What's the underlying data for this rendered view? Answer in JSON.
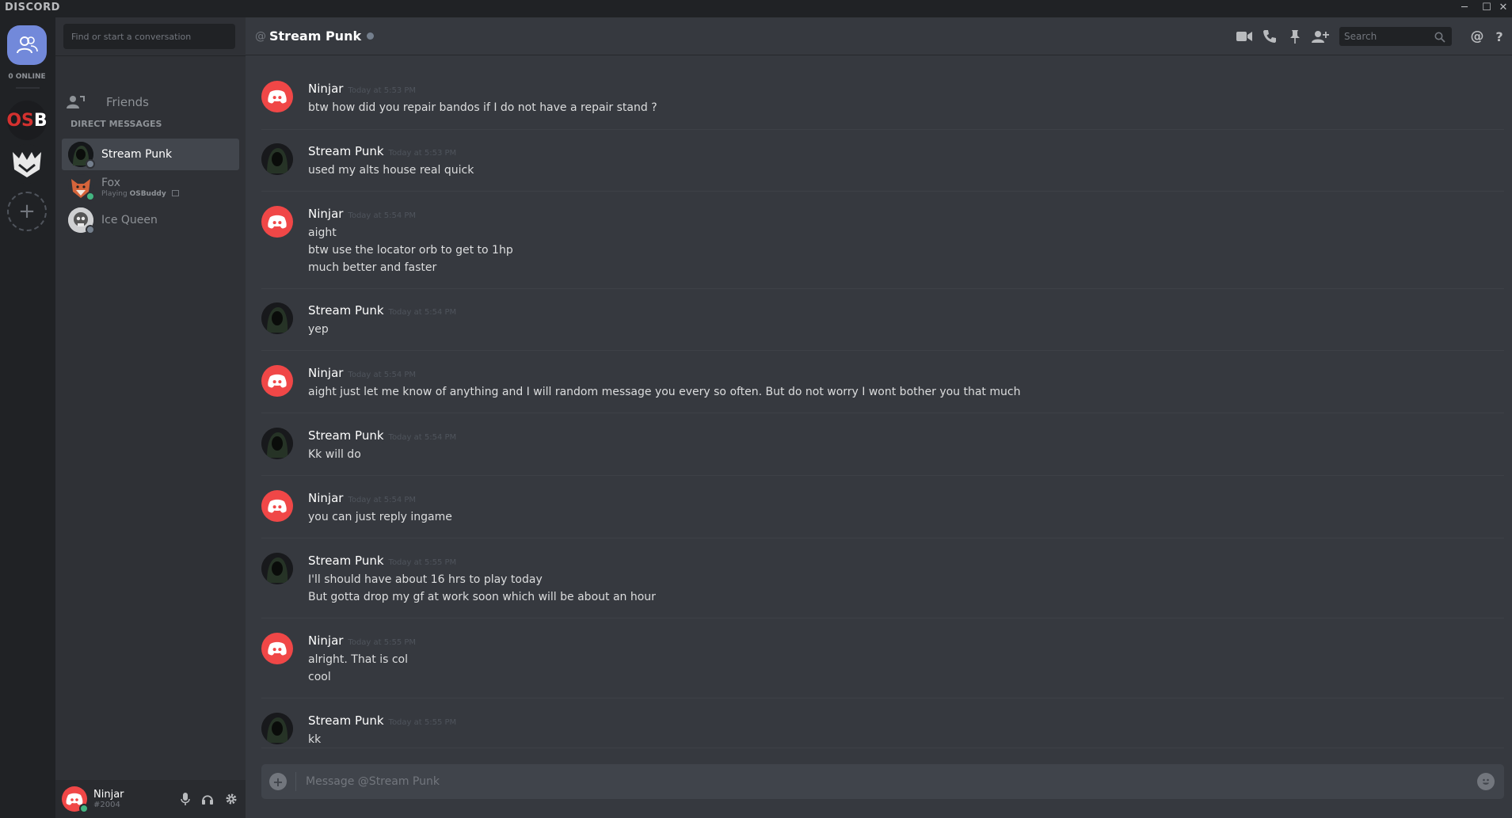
{
  "app": {
    "brand": "DISCORD",
    "window_controls": {
      "minimize": "─",
      "maximize": "☐",
      "close": "✕"
    }
  },
  "guilds": {
    "online_count": "0 ONLINE",
    "osb_label_o": "OS",
    "osb_label_b": "B",
    "add_label": "+"
  },
  "dm_sidebar": {
    "search_placeholder": "Find or start a conversation",
    "friends_label": "Friends",
    "header": "DIRECT MESSAGES",
    "items": [
      {
        "name": "Stream Punk",
        "status": "offline",
        "status_color": "#747f8d",
        "active": true
      },
      {
        "name": "Fox",
        "sub_prefix": "Playing ",
        "sub_game": "OSBuddy",
        "status": "online",
        "status_color": "#43b581",
        "active": false
      },
      {
        "name": "Ice Queen",
        "status": "offline",
        "status_color": "#747f8d",
        "active": false
      }
    ]
  },
  "user_panel": {
    "username": "Ninjar",
    "discriminator": "#2004",
    "status_color": "#43b581"
  },
  "chat_header": {
    "at_symbol": "@",
    "channel_name": "Stream Punk",
    "search_placeholder": "Search",
    "mention_icon_text": "@",
    "help_icon_text": "?"
  },
  "messages": [
    {
      "author": "Ninjar",
      "time": "Today at 5:53 PM",
      "lines": [
        "btw how did you repair bandos if I do not have a repair stand ?"
      ]
    },
    {
      "author": "Stream Punk",
      "time": "Today at 5:53 PM",
      "lines": [
        "used my alts house real quick"
      ]
    },
    {
      "author": "Ninjar",
      "time": "Today at 5:54 PM",
      "lines": [
        "aight",
        "btw use the locator orb to get to 1hp",
        "much better and faster"
      ]
    },
    {
      "author": "Stream Punk",
      "time": "Today at 5:54 PM",
      "lines": [
        "yep"
      ]
    },
    {
      "author": "Ninjar",
      "time": "Today at 5:54 PM",
      "lines": [
        "aight just let me know of anything and I will random message you every so often. But do not worry I wont bother you that much"
      ]
    },
    {
      "author": "Stream Punk",
      "time": "Today at 5:54 PM",
      "lines": [
        "Kk will do"
      ]
    },
    {
      "author": "Ninjar",
      "time": "Today at 5:54 PM",
      "lines": [
        "you can just reply ingame"
      ]
    },
    {
      "author": "Stream Punk",
      "time": "Today at 5:55 PM",
      "lines": [
        "I'll should have about 16 hrs to play today",
        "But gotta drop my gf at work soon which will be about an hour"
      ]
    },
    {
      "author": "Ninjar",
      "time": "Today at 5:55 PM",
      "lines": [
        "alright. That is col",
        "cool"
      ]
    },
    {
      "author": "Stream Punk",
      "time": "Today at 5:55 PM",
      "lines": [
        "kk"
      ]
    }
  ],
  "composer": {
    "placeholder": "Message @Stream Punk"
  },
  "colors": {
    "accent": "#7289da",
    "ninjar_avatar": "#f04747",
    "online": "#43b581",
    "offline": "#747f8d"
  }
}
